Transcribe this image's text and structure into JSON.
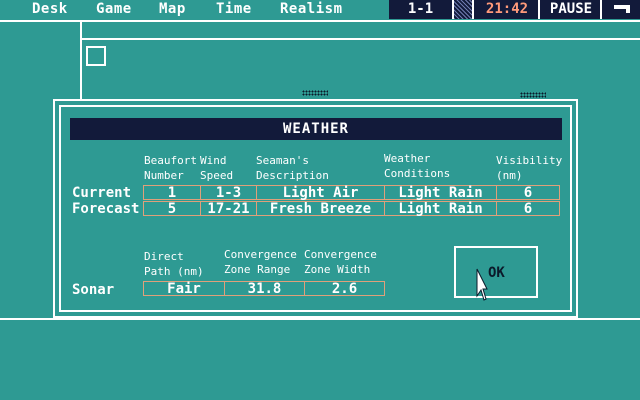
{
  "menu": [
    "Desk",
    "Game",
    "Map",
    "Time",
    "Realism"
  ],
  "status": {
    "scenario": "1-1",
    "clock": "21:42",
    "pause": "PAUSE",
    "pause_icon": "window-icon",
    "clock_color": "#ff9a7a"
  },
  "dialog": {
    "title": "WEATHER",
    "weather_headers": {
      "beaufort": [
        "Beaufort",
        "Number"
      ],
      "wind": [
        "Wind",
        "Speed"
      ],
      "seaman": [
        "Seaman's",
        "Description"
      ],
      "conditions": [
        "Weather",
        "Conditions"
      ],
      "visibility": [
        "Visibility",
        "(nm)"
      ]
    },
    "rows": [
      {
        "label": "Current",
        "beaufort": "1",
        "wind": "1-3",
        "description": "Light Air",
        "conditions": "Light Rain",
        "visibility": "6"
      },
      {
        "label": "Forecast",
        "beaufort": "5",
        "wind": "17-21",
        "description": "Fresh Breeze",
        "conditions": "Light Rain",
        "visibility": "6"
      }
    ],
    "sonar_headers": {
      "direct": [
        "Direct",
        "Path (nm)"
      ],
      "range": [
        "Convergence",
        "Zone Range"
      ],
      "width": [
        "Convergence",
        "Zone Width"
      ]
    },
    "sonar": {
      "label": "Sonar",
      "direct": "Fair",
      "range": "31.8",
      "width": "2.6"
    },
    "ok_label": "OK"
  }
}
